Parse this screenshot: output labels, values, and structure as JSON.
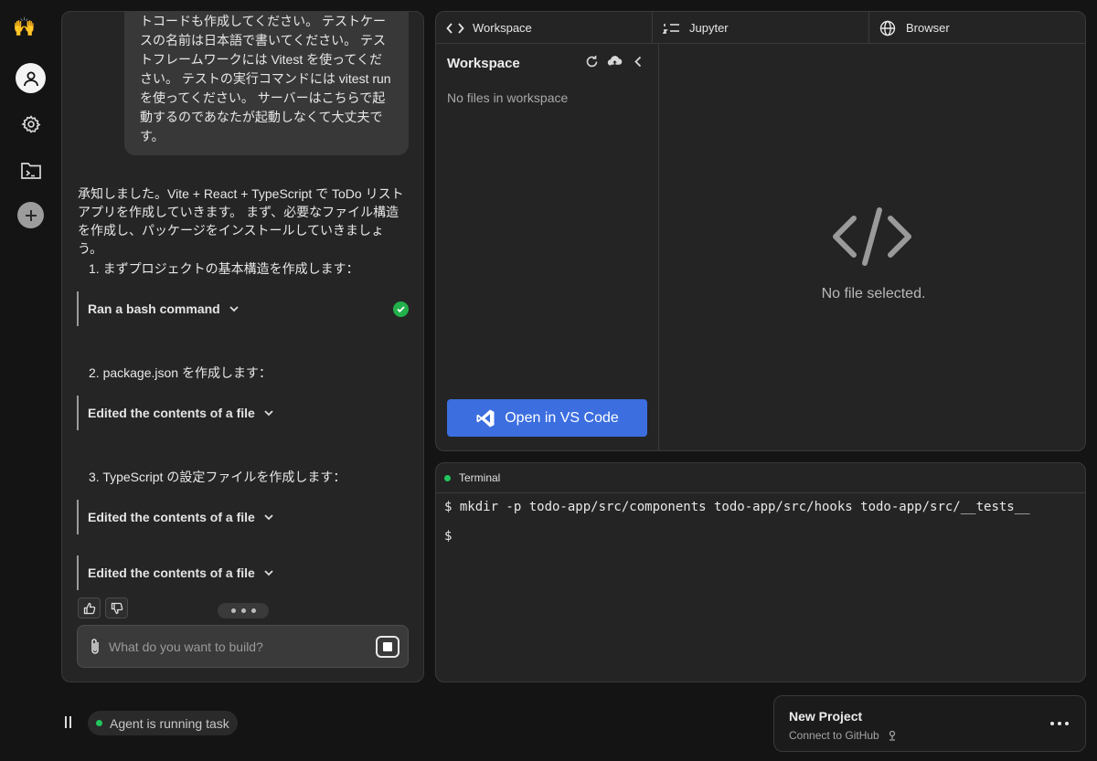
{
  "rail": {
    "logo": "🙌"
  },
  "chat": {
    "user_message": "トコードも作成してください。 テストケースの名前は日本語で書いてください。 テストフレームワークには Vitest を使ってください。 テストの実行コマンドには vitest run を使ってください。 サーバーはこちらで起動するのであなたが起動しなくて大丈夫です。",
    "assistant_intro": "承知しました。Vite + React + TypeScript で ToDo リストアプリを作成していきます。 まず、必要なファイル構造を作成し、パッケージをインストールしていきましょう。",
    "steps": [
      "1. まずプロジェクトの基本構造を作成します：",
      "2. package.json を作成します：",
      "3. TypeScript の設定ファイルを作成します："
    ],
    "tools": [
      {
        "label": "Ran a bash command",
        "status": "success"
      },
      {
        "label": "Edited the contents of a file"
      },
      {
        "label": "Edited the contents of a file"
      },
      {
        "label": "Edited the contents of a file"
      }
    ],
    "composer_placeholder": "What do you want to build?"
  },
  "status": {
    "agent_text": "Agent is running task",
    "status_color": "#22c55e"
  },
  "workspace": {
    "tabs": [
      {
        "label": "Workspace",
        "icon": "code-icon"
      },
      {
        "label": "Jupyter",
        "icon": "list-icon"
      },
      {
        "label": "Browser",
        "icon": "globe-icon"
      }
    ],
    "file_tree_title": "Workspace",
    "empty_files": "No files in workspace",
    "open_vscode_label": "Open in VS Code",
    "viewer_empty": "No file selected."
  },
  "terminal": {
    "title": "Terminal",
    "lines": [
      "$ mkdir -p todo-app/src/components todo-app/src/hooks todo-app/src/__tests__",
      "$"
    ]
  },
  "project": {
    "name": "New Project",
    "subtitle": "Connect to GitHub"
  },
  "colors": {
    "accent": "#3c6ee0",
    "success": "#22b04b",
    "background": "#141414",
    "panel": "#252525"
  }
}
